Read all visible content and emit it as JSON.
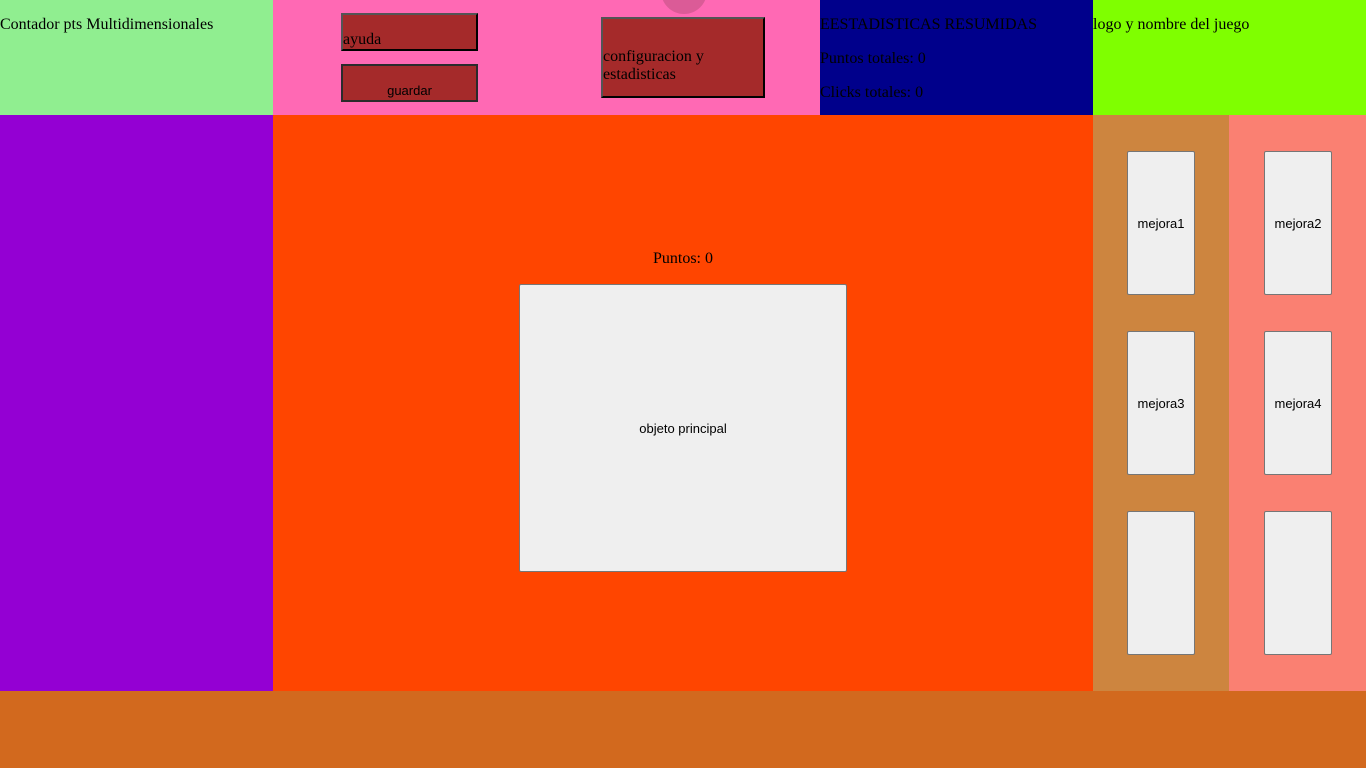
{
  "header": {
    "counter_title": "Contador pts Multidimensionales",
    "logo_text": "logo y nombre del juego"
  },
  "menu": {
    "help_label": "ayuda",
    "save_label": "guardar",
    "config_label_line1": "configuracion y",
    "config_label_line2": "estadisticas"
  },
  "stats": {
    "title": "EESTADISTICAS RESUMIDAS",
    "total_points": "Puntos totales: 0",
    "total_clicks": "Clicks totales: 0"
  },
  "game": {
    "points": "Puntos: 0",
    "main_object_label": "objeto principal"
  },
  "upgrades": {
    "u1": "mejora1",
    "u2": "mejora2",
    "u3": "mejora3",
    "u4": "mejora4",
    "u5": "",
    "u6": ""
  },
  "colors": {
    "counter_panel": "#90ee90",
    "menu_panel": "#ff69b4",
    "menu_buttons": "#a52a2a",
    "stats_panel": "#00008b",
    "logo_panel": "#7fff00",
    "left_panel": "#9400d3",
    "main_panel": "#ff4500",
    "upgrades_panel_a": "#cd853f",
    "upgrades_panel_b": "#fa8072",
    "bottom_panel": "#d2691e"
  }
}
